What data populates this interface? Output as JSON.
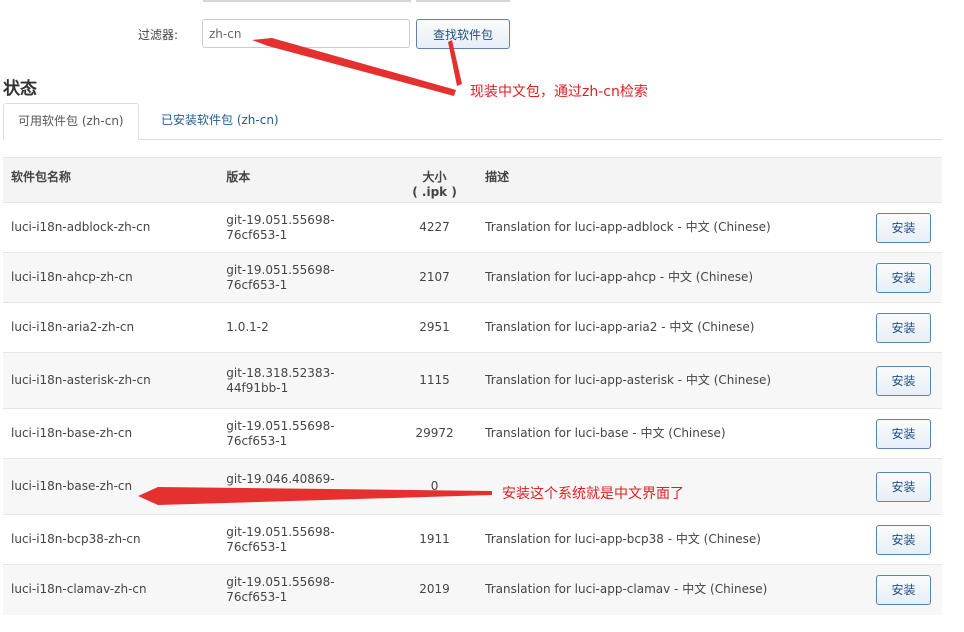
{
  "filter": {
    "label": "过滤器:",
    "value": "zh-cn",
    "button_label": "查找软件包"
  },
  "section_title": "状态",
  "tabs": [
    {
      "label": "可用软件包 (zh-cn)",
      "active": true
    },
    {
      "label": "已安装软件包 (zh-cn)",
      "active": false
    }
  ],
  "table": {
    "headers": {
      "name": "软件包名称",
      "version": "版本",
      "size_line1": "大小",
      "size_line2": "( .ipk )",
      "description": "描述"
    },
    "rows": [
      {
        "name": "luci-i18n-adblock-zh-cn",
        "version": "git-19.051.55698-76cf653-1",
        "size": "4227",
        "description": "Translation for luci-app-adblock - 中文 (Chinese)",
        "action": "安装"
      },
      {
        "name": "luci-i18n-ahcp-zh-cn",
        "version": "git-19.051.55698-76cf653-1",
        "size": "2107",
        "description": "Translation for luci-app-ahcp - 中文 (Chinese)",
        "action": "安装"
      },
      {
        "name": "luci-i18n-aria2-zh-cn",
        "version": "1.0.1-2",
        "size": "2951",
        "description": "Translation for luci-app-aria2 - 中文 (Chinese)",
        "action": "安装"
      },
      {
        "name": "luci-i18n-asterisk-zh-cn",
        "version": "git-18.318.52383-44f91bb-1",
        "size": "1115",
        "description": "Translation for luci-app-asterisk - 中文 (Chinese)",
        "action": "安装"
      },
      {
        "name": "luci-i18n-base-zh-cn",
        "version": "git-19.051.55698-76cf653-1",
        "size": "29972",
        "description": "Translation for luci-base - 中文 (Chinese)",
        "action": "安装"
      },
      {
        "name": "luci-i18n-base-zh-cn",
        "version": "git-19.046.40869-30d9bc0-1",
        "size": "0",
        "description": "",
        "action": "安装"
      },
      {
        "name": "luci-i18n-bcp38-zh-cn",
        "version": "git-19.051.55698-76cf653-1",
        "size": "1911",
        "description": "Translation for luci-app-bcp38 - 中文 (Chinese)",
        "action": "安装"
      },
      {
        "name": "luci-i18n-clamav-zh-cn",
        "version": "git-19.051.55698-76cf653-1",
        "size": "2019",
        "description": "Translation for luci-app-clamav - 中文 (Chinese)",
        "action": "安装"
      }
    ]
  },
  "annotations": {
    "arrow_color": "#e53030",
    "note1": "现装中文包，通过zh-cn检索",
    "note2": "安装这个系统就是中文界面了"
  }
}
